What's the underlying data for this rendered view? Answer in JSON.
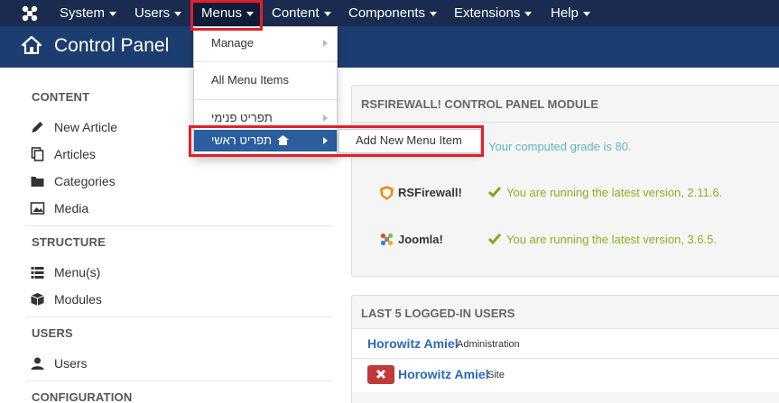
{
  "topbar": {
    "menus": [
      {
        "label": "System",
        "name": "menu-system"
      },
      {
        "label": "Users",
        "name": "menu-users"
      },
      {
        "label": "Menus",
        "name": "menu-menus"
      },
      {
        "label": "Content",
        "name": "menu-content"
      },
      {
        "label": "Components",
        "name": "menu-components"
      },
      {
        "label": "Extensions",
        "name": "menu-extensions"
      },
      {
        "label": "Help",
        "name": "menu-help"
      }
    ]
  },
  "header": {
    "title": "Control Panel"
  },
  "sidebar": {
    "content_heading": "CONTENT",
    "new_article": "New Article",
    "articles": "Articles",
    "categories": "Categories",
    "media": "Media",
    "structure_heading": "STRUCTURE",
    "menus": "Menu(s)",
    "modules": "Modules",
    "users_heading": "USERS",
    "users": "Users",
    "configuration_heading": "CONFIGURATION"
  },
  "rsfirewall_panel": {
    "title": "RSFIREWALL! CONTROL PANEL MODULE",
    "grade_prefix": "Your computed grade is ",
    "grade_value": "80",
    "grade_suffix": ".",
    "rows": [
      {
        "label": "RSFirewall!",
        "message": "You are running the latest version, 2.11.6."
      },
      {
        "label": "Joomla!",
        "message": "You are running the latest version, 3.6.5."
      }
    ]
  },
  "logged_users_panel": {
    "title": "LAST 5 LOGGED-IN USERS",
    "rows": [
      {
        "name": "Horowitz Amiel",
        "location": "Administration"
      },
      {
        "name": "Horowitz Amiel",
        "location": "Site"
      }
    ]
  },
  "menus_dropdown": {
    "manage": "Manage",
    "all_menu_items": "All Menu Items",
    "internal_menu": "תפריט פנימי",
    "main_menu": "תפריט ראשי",
    "add_new_menu_item": "Add New Menu Item"
  },
  "colors": {
    "navbar": "#1a2b4f",
    "titlebar": "#1c3d70",
    "highlight": "#2a5e9c",
    "annotation_red": "#e0202a",
    "success_green": "#8ab31a"
  }
}
